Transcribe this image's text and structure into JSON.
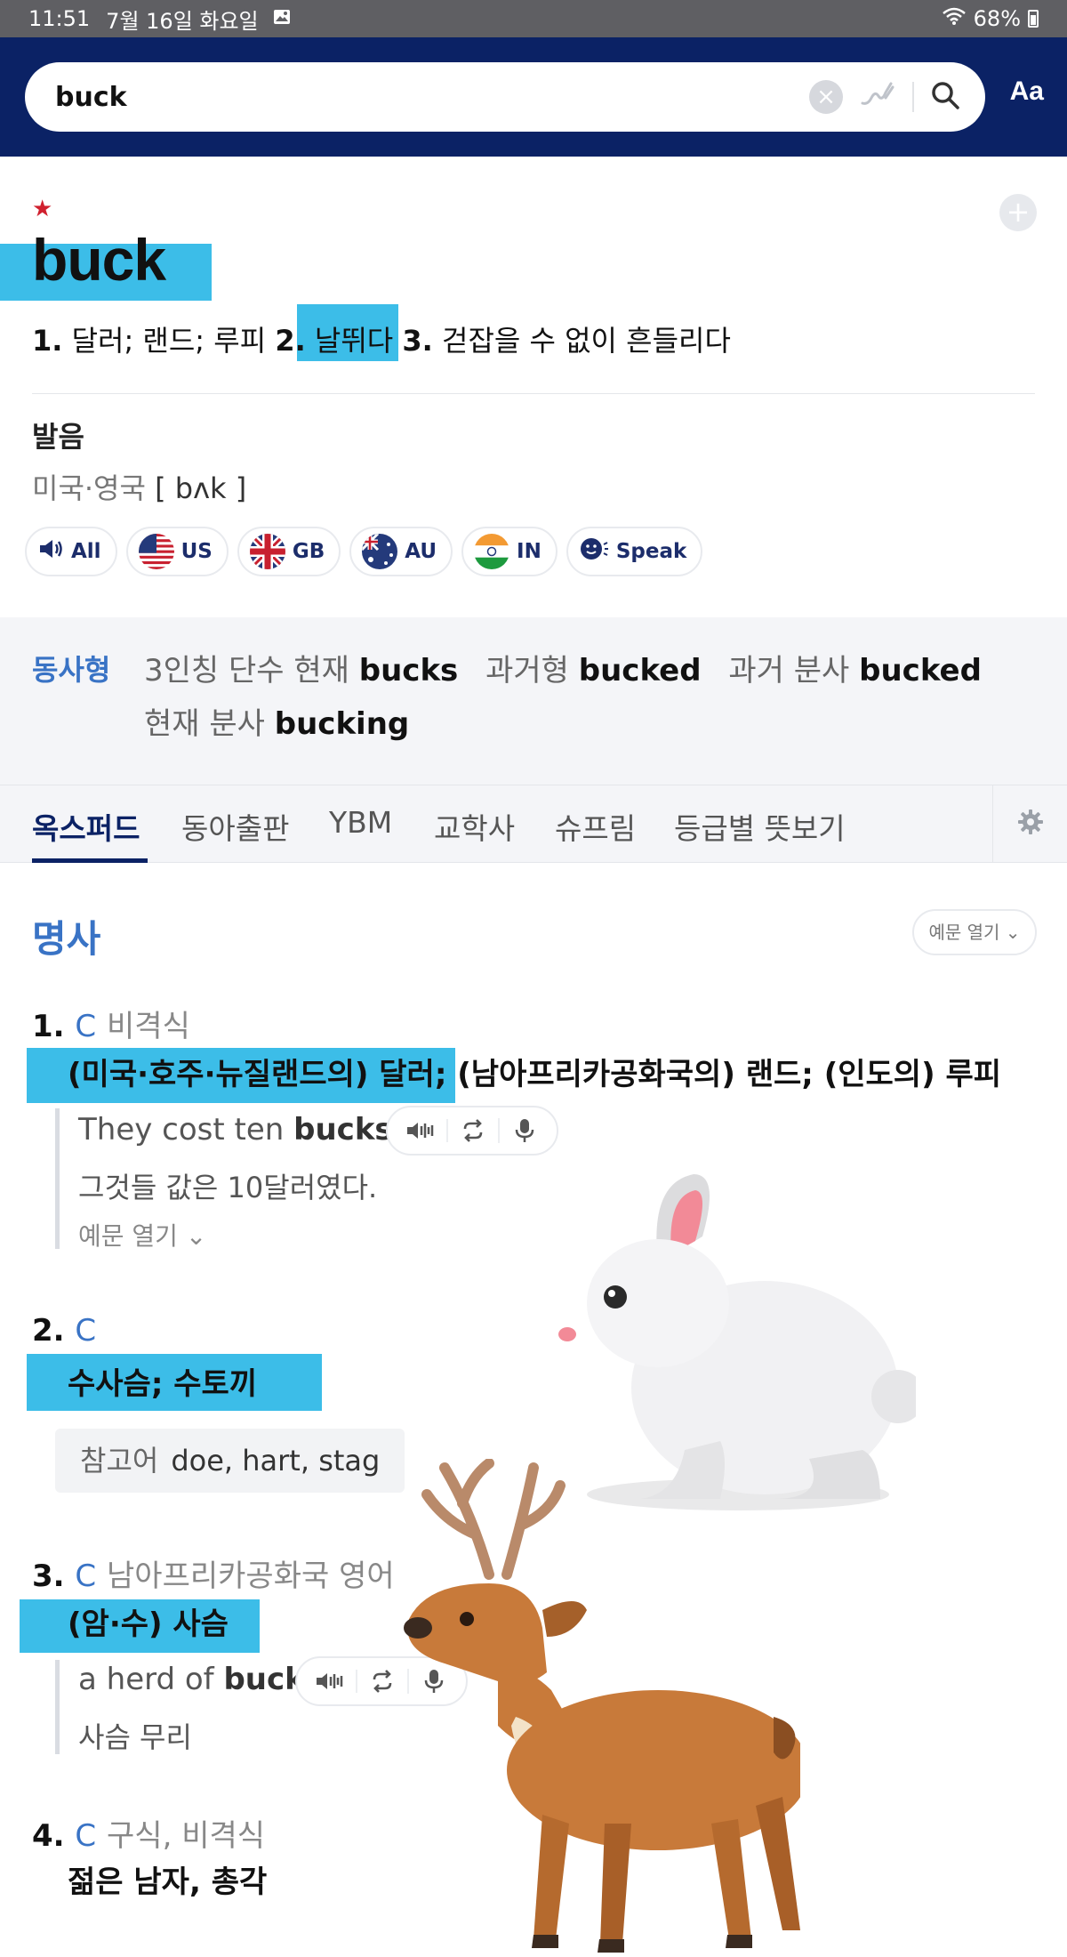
{
  "status_bar": {
    "time": "11:51",
    "date": "7월 16일 화요일",
    "battery": "68%"
  },
  "search": {
    "query": "buck",
    "font_button": "Aa"
  },
  "entry": {
    "headword": "buck",
    "summary": {
      "n1": "1.",
      "t1": " 달러; 랜드; 루피 ",
      "n2": "2.",
      "t2": " 날뛰다 ",
      "n3": "3.",
      "t3": " 걷잡을 수 없이 흔들리다"
    }
  },
  "pronunciation": {
    "title": "발음",
    "region": "미국·영국",
    "ipa": "[ bʌk ]",
    "buttons": [
      "All",
      "US",
      "GB",
      "AU",
      "IN",
      "Speak"
    ]
  },
  "verb_forms": {
    "label": "동사형",
    "third_person_label": "3인칭 단수 현재",
    "third_person": "bucks",
    "past_label": "과거형",
    "past": "bucked",
    "past_participle_label": "과거 분사",
    "past_participle": "bucked",
    "present_participle_label": "현재 분사",
    "present_participle": "bucking"
  },
  "tabs": [
    "옥스퍼드",
    "동아출판",
    "YBM",
    "교학사",
    "슈프림",
    "등급별 뜻보기"
  ],
  "part_of_speech": "명사",
  "example_toggle": "예문 열기",
  "senses": [
    {
      "num": "1.",
      "gram": "C",
      "register": "비격식",
      "definition": "(미국·호주·뉴질랜드의) 달러; (남아프리카공화국의) 랜드; (인도의) 루피",
      "example_en_pre": "They cost ten ",
      "example_en_bold": "bucks",
      "example_en_post": ".",
      "example_ko": "그것들 값은 10달러였다.",
      "more_examples": "예문 열기"
    },
    {
      "num": "2.",
      "gram": "C",
      "definition": "수사슴; 수토끼",
      "ref_label": "참고어",
      "ref_words": "doe, hart, stag"
    },
    {
      "num": "3.",
      "gram": "C",
      "register": "남아프리카공화국 영어",
      "definition": "(암·수) 사슴",
      "example_en_pre": "a herd of ",
      "example_en_bold": "buck",
      "example_ko": "사슴 무리"
    },
    {
      "num": "4.",
      "gram": "C",
      "register": "구식, 비격식",
      "definition": "젊은 남자, 총각"
    }
  ],
  "colors": {
    "header": "#0b2265",
    "accent": "#3973c5",
    "highlight": "#3cbde8",
    "star": "#d0202e"
  }
}
